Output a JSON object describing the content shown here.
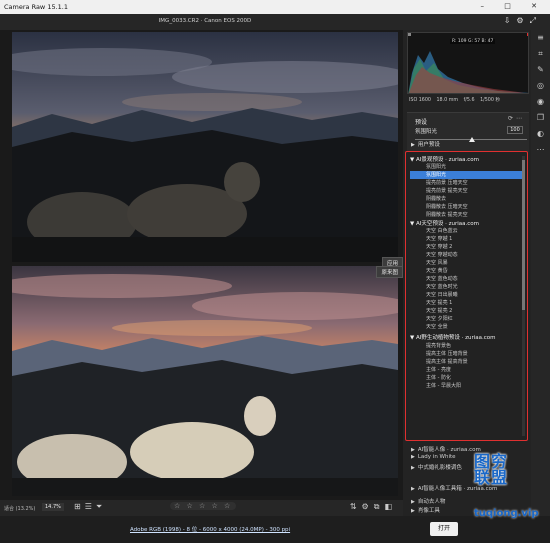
{
  "window": {
    "app_title": "Camera Raw 15.1.1",
    "controls": [
      "–",
      "□",
      "✕"
    ]
  },
  "file": {
    "name": "IMG_0033.CR2  ·  Canon EOS 200D"
  },
  "viewer": {
    "before_tag": "应用",
    "after_tag": "原来图"
  },
  "bottombar": {
    "zoom_label": "适合 (13.2%)",
    "zoom_value": "14.7%",
    "rating": "☆ ☆ ☆ ☆ ☆"
  },
  "status": {
    "info_link": "Adobe RGB (1998) - 8 位 - 6000 x 4000 (24.0MP) - 300 ppi",
    "open_label": "打开"
  },
  "histogram": {
    "rgb_readout": "R: 109   G: 57   B: 47"
  },
  "exif": [
    "ISO 1600",
    "18.0 mm",
    "f/5.6",
    "1/500 秒"
  ],
  "presets": {
    "title": "预设",
    "amount_label": "氛围阳光",
    "amount_value": "100",
    "amount_fraction": 0.5,
    "user_group": "用户预设",
    "groups": [
      {
        "title": "AI景观预设 · zuriaa.com",
        "items": [
          "氛围阳光",
          "氛围阳光",
          "提亮前景 压暗天空",
          "提亮前景 提亮天空",
          "阴霾散去",
          "阴霾散去 压暗天空",
          "阴霾散去 提亮天空"
        ],
        "selected": 1
      },
      {
        "title": "AI天空预设 · zuriaa.com",
        "items": [
          "天空 白色蓝云",
          "天空 穿越 1",
          "天空 穿越 2",
          "天空 穿越动态",
          "天空 风暴",
          "天空 黄昏",
          "天空 蓝色动态",
          "天空 蓝色时光",
          "天空 日出晨曦",
          "天空 提亮 1",
          "天空 提亮 2",
          "天空 夕阳红",
          "天空 全景"
        ]
      },
      {
        "title": "AI野生动植物预设 · zuriaa.com",
        "items": [
          "提亮背景色",
          "提高主体 压暗背景",
          "提高主体 提高背景",
          "主体 - 亮度",
          "主体 - 防化",
          "主体 - 早晨大阳"
        ]
      }
    ],
    "lower_groups": [
      "AI智能人像 · zuriaa.com",
      "Lady in White",
      "中式婚礼影楼调色",
      "AI智能人像工具箱 · zuriaa.com",
      "自动去人物",
      "肖像工具"
    ]
  },
  "watermark": {
    "line1": "图穷",
    "line2": "联盟",
    "site": "tuqiong.vip",
    "side": "WWW.ZURIAA.COM"
  },
  "colors": {
    "accent": "#3b7fd8",
    "highlight_border": "#e03030",
    "watermark": "#1a68c8"
  }
}
